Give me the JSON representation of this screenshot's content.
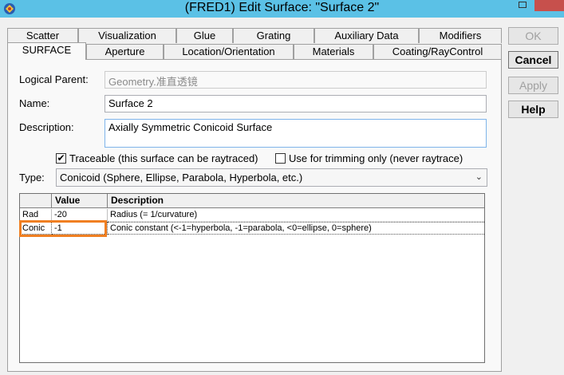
{
  "window": {
    "title": "(FRED1) Edit Surface: \"Surface 2\""
  },
  "tabs_row1": [
    "Scatter",
    "Visualization",
    "Glue",
    "Grating",
    "Auxiliary Data",
    "Modifiers"
  ],
  "tabs_row2": [
    "SURFACE",
    "Aperture",
    "Location/Orientation",
    "Materials",
    "Coating/RayControl"
  ],
  "active_tab": "SURFACE",
  "buttons": {
    "ok": "OK",
    "cancel": "Cancel",
    "apply": "Apply",
    "help": "Help"
  },
  "form": {
    "logical_parent_label": "Logical Parent:",
    "logical_parent_value": "Geometry.准直透镜",
    "name_label": "Name:",
    "name_value": "Surface 2",
    "description_label": "Description:",
    "description_value": "Axially Symmetric Conicoid Surface",
    "traceable_label": "Traceable (this surface can be raytraced)",
    "traceable_checked": true,
    "trimming_label": "Use for trimming only (never raytrace)",
    "trimming_checked": false,
    "type_label": "Type:",
    "type_value": "Conicoid   (Sphere, Ellipse, Parabola, Hyperbola, etc.)"
  },
  "table": {
    "headers": [
      "",
      "Value",
      "Description"
    ],
    "rows": [
      {
        "name": "Rad",
        "value": "-20",
        "description": "Radius   (= 1/curvature)"
      },
      {
        "name": "Conic",
        "value": "-1",
        "description": "Conic constant (<-1=hyperbola, -1=parabola, <0=ellipse, 0=sphere)"
      }
    ]
  },
  "colors": {
    "titlebar": "#5bc1e6",
    "highlight": "#f07f22",
    "close": "#c7504c"
  }
}
